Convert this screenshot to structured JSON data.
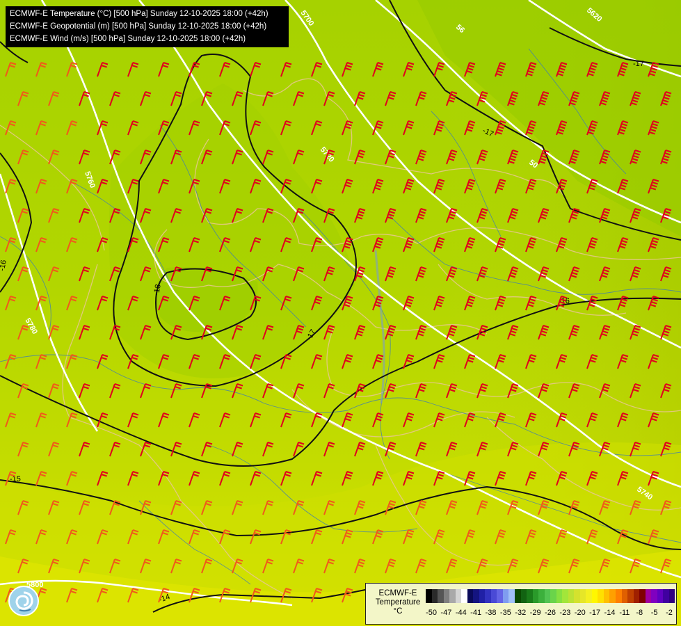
{
  "header": {
    "line1": "ECMWF-E Temperature (°C) [500 hPa] Sunday 12-10-2025 18:00 (+42h)",
    "line2": "ECMWF-E Geopotential (m) [500 hPa] Sunday 12-10-2025 18:00 (+42h)",
    "line3": "ECMWF-E Wind (m/s) [500 hPa] Sunday 12-10-2025 18:00 (+42h)"
  },
  "contour_labels": {
    "geopotential": [
      "5700",
      "56",
      "5620",
      "5720",
      "50",
      "5760",
      "5780",
      "5740",
      "5800"
    ],
    "temperature": [
      "-17",
      "-17",
      "-16",
      "-18",
      "-17",
      "-16",
      "-15",
      "-14"
    ]
  },
  "legend": {
    "title_line1": "ECMWF-E",
    "title_line2": "Temperature",
    "unit": "°C",
    "tick_labels": [
      "-50",
      "-47",
      "-44",
      "-41",
      "-38",
      "-35",
      "-32",
      "-29",
      "-26",
      "-23",
      "-20",
      "-17",
      "-14",
      "-11",
      "-8",
      "-5",
      "-2"
    ],
    "colors": [
      "#000000",
      "#2a2a2a",
      "#555555",
      "#7f7f7f",
      "#a9a9a9",
      "#d4d4d4",
      "#ffffff",
      "#0a0a5a",
      "#141480",
      "#2020a6",
      "#3232c0",
      "#4a4ad6",
      "#6464e6",
      "#7f9cf0",
      "#a0c0f8",
      "#0a4a00",
      "#126312",
      "#1a7c1a",
      "#2a9a2a",
      "#3cb03c",
      "#52c452",
      "#6ad44a",
      "#86e040",
      "#a2e63a",
      "#bce234",
      "#d4e22e",
      "#e6e628",
      "#f4f020",
      "#fff700",
      "#ffe000",
      "#ffc000",
      "#ffa000",
      "#ff8000",
      "#e06000",
      "#c04000",
      "#a02000",
      "#800000",
      "#a000a0",
      "#8000c0",
      "#6000c0",
      "#4000a0",
      "#300080"
    ]
  },
  "logo": {
    "icon": "ecmwf-swirl-logo"
  }
}
